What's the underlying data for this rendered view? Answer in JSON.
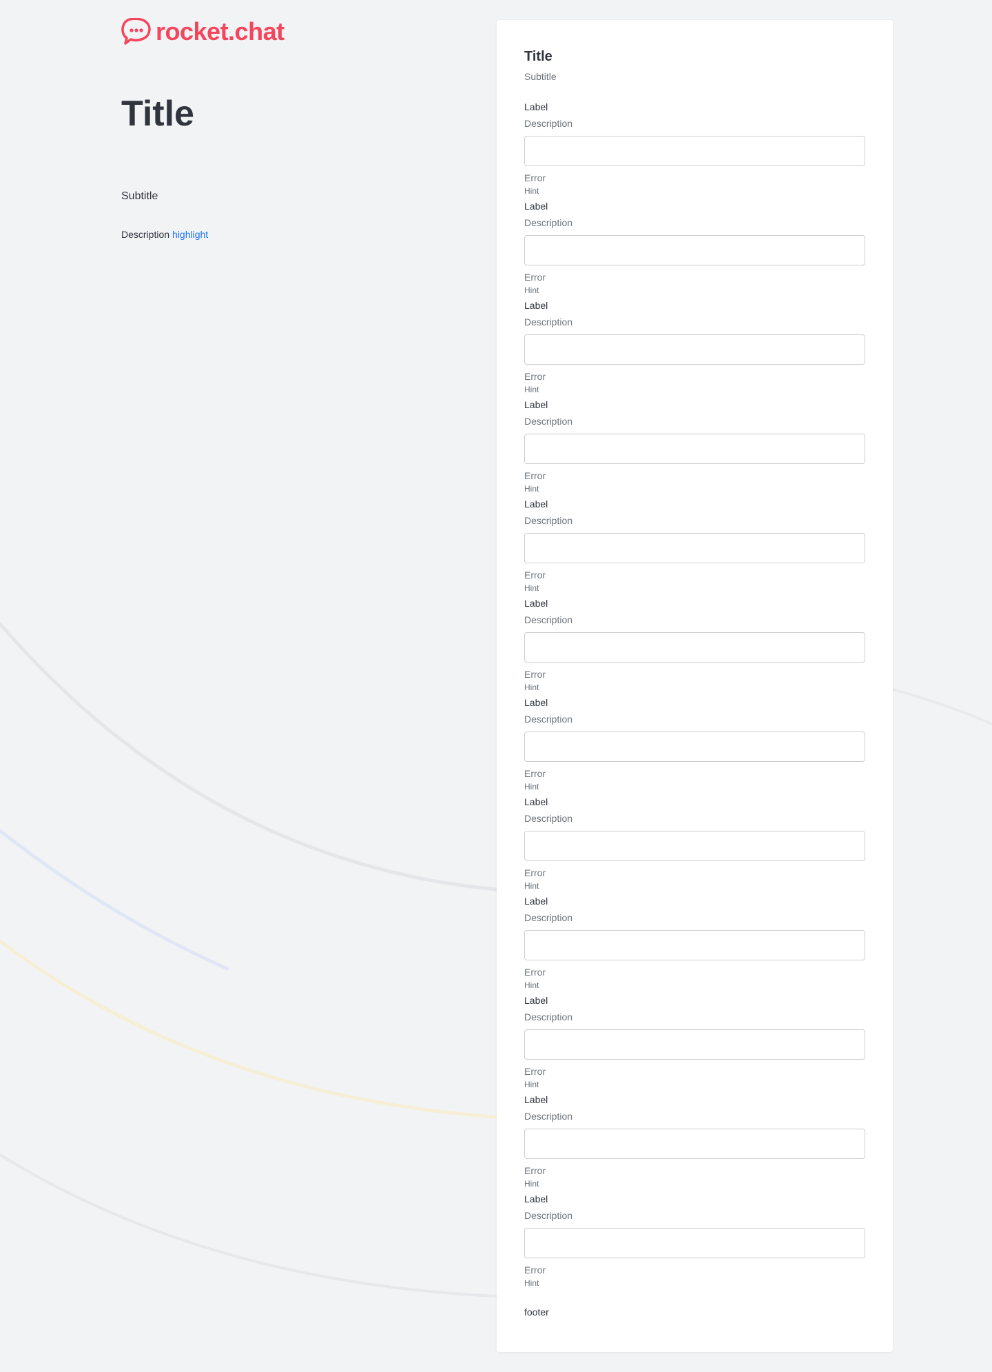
{
  "brand": {
    "name": "rocket.chat",
    "color": "#f5455c"
  },
  "hero": {
    "title": "Title",
    "subtitle": "Subtitle",
    "description": "Description",
    "highlight": "highlight",
    "highlight_color": "#1d74f5"
  },
  "form": {
    "title": "Title",
    "subtitle": "Subtitle",
    "fields": [
      {
        "label": "Label",
        "description": "Description",
        "value": "",
        "error": "Error",
        "hint": "Hint"
      },
      {
        "label": "Label",
        "description": "Description",
        "value": "",
        "error": "Error",
        "hint": "Hint"
      },
      {
        "label": "Label",
        "description": "Description",
        "value": "",
        "error": "Error",
        "hint": "Hint"
      },
      {
        "label": "Label",
        "description": "Description",
        "value": "",
        "error": "Error",
        "hint": "Hint"
      },
      {
        "label": "Label",
        "description": "Description",
        "value": "",
        "error": "Error",
        "hint": "Hint"
      },
      {
        "label": "Label",
        "description": "Description",
        "value": "",
        "error": "Error",
        "hint": "Hint"
      },
      {
        "label": "Label",
        "description": "Description",
        "value": "",
        "error": "Error",
        "hint": "Hint"
      },
      {
        "label": "Label",
        "description": "Description",
        "value": "",
        "error": "Error",
        "hint": "Hint"
      },
      {
        "label": "Label",
        "description": "Description",
        "value": "",
        "error": "Error",
        "hint": "Hint"
      },
      {
        "label": "Label",
        "description": "Description",
        "value": "",
        "error": "Error",
        "hint": "Hint"
      },
      {
        "label": "Label",
        "description": "Description",
        "value": "",
        "error": "Error",
        "hint": "Hint"
      },
      {
        "label": "Label",
        "description": "Description",
        "value": "",
        "error": "Error",
        "hint": "Hint"
      }
    ],
    "footer": "footer"
  },
  "icons": {
    "logo": "rocket-chat-logo-icon"
  }
}
